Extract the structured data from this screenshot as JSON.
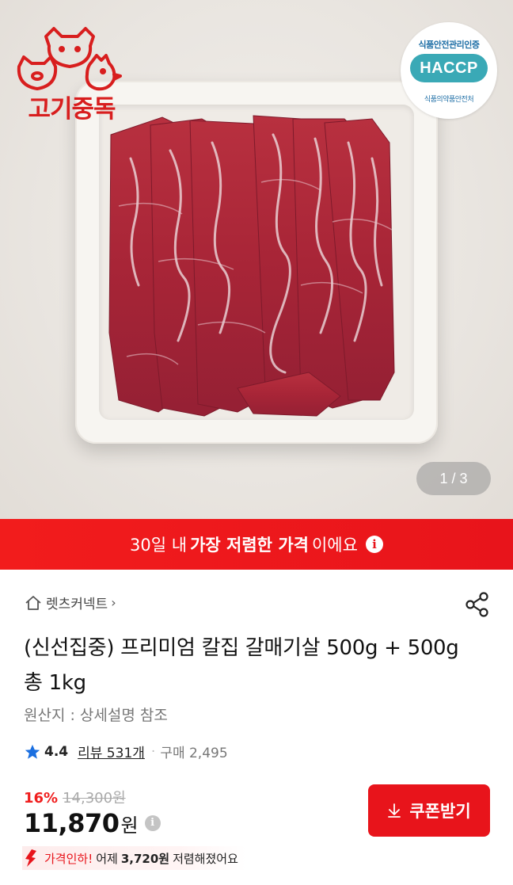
{
  "brand": {
    "logo_text": "고기중독"
  },
  "haccp": {
    "top_text": "식품안전관리인증",
    "badge": "HACCP",
    "bottom_text": "식품의약품안전처"
  },
  "gallery": {
    "indicator": "1 / 3"
  },
  "banner": {
    "pre": "30일 내",
    "strong": "가장 저렴한 가격",
    "post": "이에요",
    "icon": "info-icon"
  },
  "product": {
    "store_name": "렛츠커넥트",
    "title": "(신선집중) 프리미엄 칼집 갈매기살 500g + 500g 총 1kg",
    "origin": "원산지 : 상세설명 참조",
    "rating": "4.4",
    "review_label": "리뷰 531개",
    "purchase_label": "구매 2,495",
    "discount": "16%",
    "original_price": "14,300원",
    "price": "11,870",
    "price_unit": "원",
    "drop": {
      "prefix": "가격인하!",
      "mid": "어제",
      "amount": "3,720원",
      "suffix": "저렴해졌어요"
    }
  },
  "actions": {
    "coupon_label": "쿠폰받기"
  },
  "colors": {
    "accent": "#e8141b",
    "haccp": "#3aa9b6",
    "star": "#1a6fe0"
  }
}
